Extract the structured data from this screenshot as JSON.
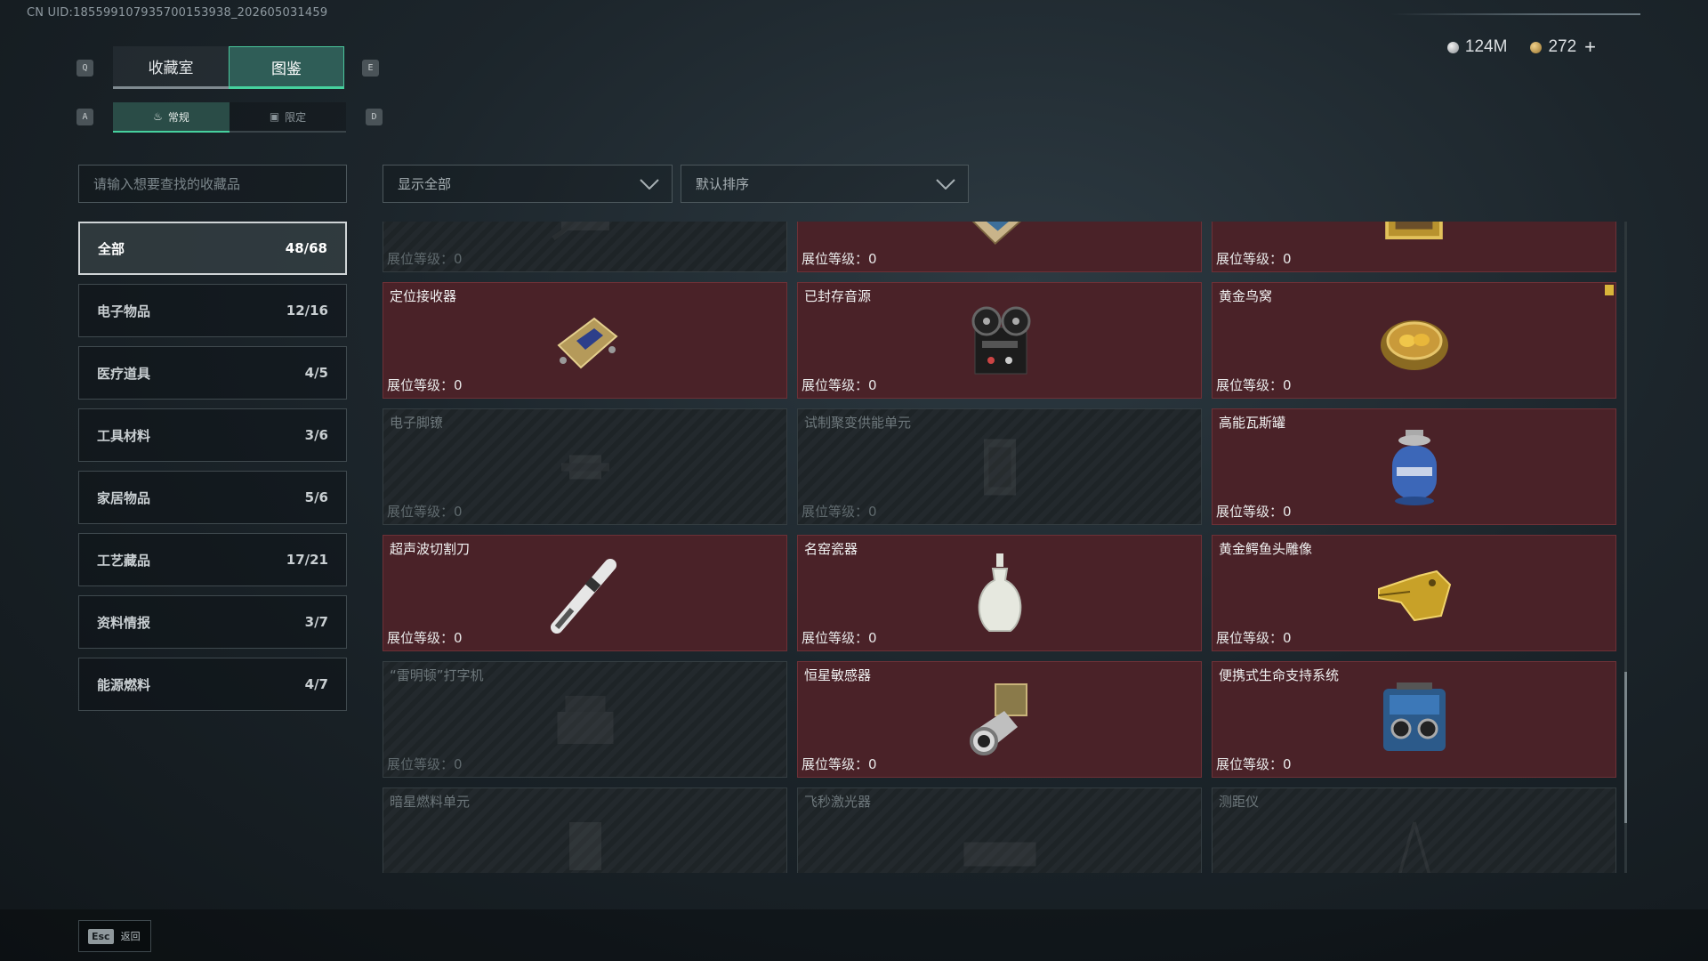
{
  "uid": "CN UID:18559910793570015393​8_202605031459",
  "currency": {
    "silver": "124M",
    "gold": "272",
    "plus": "+"
  },
  "keys": {
    "prev_tab": "Q",
    "next_tab": "E",
    "prev_sub": "A",
    "next_sub": "D"
  },
  "main_tabs": [
    {
      "label": "收藏室",
      "active": false
    },
    {
      "label": "图鉴",
      "active": true
    }
  ],
  "sub_tabs": [
    {
      "label": "常规",
      "icon": "flame-icon",
      "active": true
    },
    {
      "label": "限定",
      "icon": "card-icon",
      "active": false
    }
  ],
  "search": {
    "placeholder": "请输入想要查找的收藏品"
  },
  "filter": {
    "value": "显示全部"
  },
  "sort": {
    "value": "默认排序"
  },
  "categories": [
    {
      "label": "全部",
      "count": "48/68",
      "active": true
    },
    {
      "label": "电子物品",
      "count": "12/16"
    },
    {
      "label": "医疗道具",
      "count": "4/5"
    },
    {
      "label": "工具材料",
      "count": "3/6"
    },
    {
      "label": "家居物品",
      "count": "5/6"
    },
    {
      "label": "工艺藏品",
      "count": "17/21"
    },
    {
      "label": "资料情报",
      "count": "3/7"
    },
    {
      "label": "能源燃料",
      "count": "4/7"
    }
  ],
  "level_label": "展位等级：0",
  "items": [
    {
      "name": "",
      "locked": true,
      "icon": "device-icon"
    },
    {
      "name": "",
      "locked": false,
      "icon": "map-icon"
    },
    {
      "name": "",
      "locked": false,
      "icon": "painting-icon"
    },
    {
      "name": "定位接收器",
      "locked": false,
      "icon": "receiver-icon"
    },
    {
      "name": "已封存音源",
      "locked": false,
      "icon": "reel-recorder-icon"
    },
    {
      "name": "黄金鸟窝",
      "locked": false,
      "icon": "golden-nest-icon",
      "badge": true
    },
    {
      "name": "电子脚镣",
      "locked": true,
      "icon": "ankle-monitor-icon"
    },
    {
      "name": "试制聚变供能单元",
      "locked": true,
      "icon": "fusion-cell-icon"
    },
    {
      "name": "高能瓦斯罐",
      "locked": false,
      "icon": "gas-canister-icon"
    },
    {
      "name": "超声波切割刀",
      "locked": false,
      "icon": "ultrasonic-knife-icon"
    },
    {
      "name": "名窑瓷器",
      "locked": false,
      "icon": "porcelain-vase-icon"
    },
    {
      "name": "黄金鳄鱼头雕像",
      "locked": false,
      "icon": "gold-croc-icon"
    },
    {
      "name": "“雷明顿”打字机",
      "locked": true,
      "icon": "typewriter-icon"
    },
    {
      "name": "恒星敏感器",
      "locked": false,
      "icon": "star-sensor-icon"
    },
    {
      "name": "便携式生命支持系统",
      "locked": false,
      "icon": "life-support-icon"
    },
    {
      "name": "暗星燃料单元",
      "locked": true,
      "icon": "fuel-cell-icon"
    },
    {
      "name": "飞秒激光器",
      "locked": true,
      "icon": "laser-icon"
    },
    {
      "name": "测距仪",
      "locked": true,
      "icon": "rangefinder-icon"
    }
  ],
  "footer": {
    "esc_key": "Esc",
    "back_label": "返回"
  },
  "colors": {
    "accent": "#46d19e",
    "card_bg": "#4a2228",
    "card_border": "#6d3137",
    "locked_bg": "#23292d"
  }
}
